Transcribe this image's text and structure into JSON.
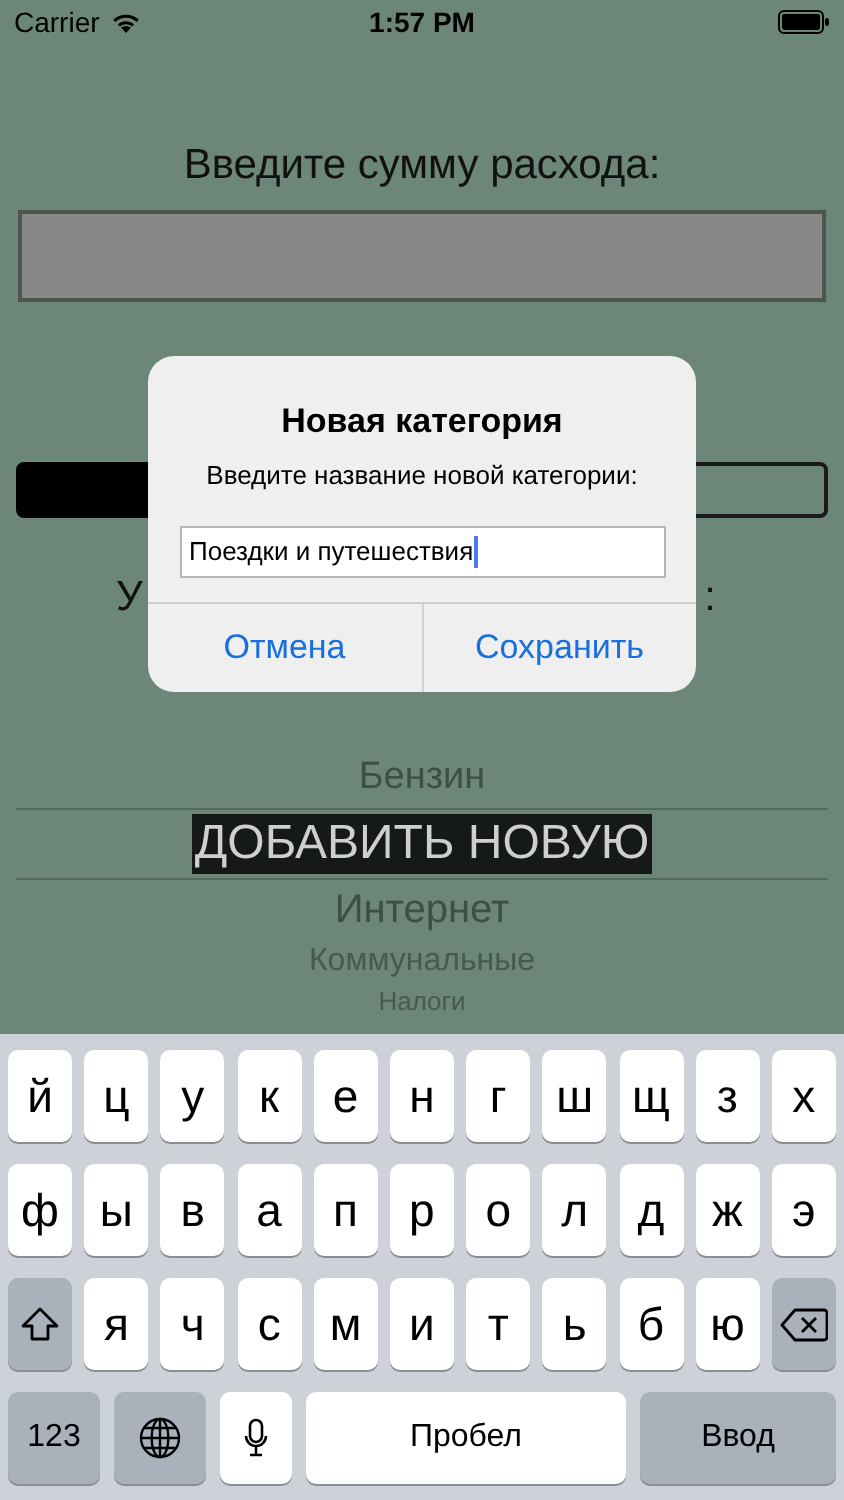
{
  "status_bar": {
    "carrier": "Carrier",
    "time": "1:57 PM"
  },
  "amount_label": "Введите сумму расхода:",
  "buttons_row": [
    {
      "kind": "filled"
    },
    {
      "kind": "outlined"
    }
  ],
  "covered_label": {
    "left": "У",
    "right": ":"
  },
  "picker": [
    {
      "label": "Бензин",
      "selected": false
    },
    {
      "label": "ДОБАВИТЬ НОВУЮ",
      "selected": true
    },
    {
      "label": "Интернет",
      "selected": false
    },
    {
      "label": "Коммунальные",
      "selected": false
    },
    {
      "label": "Налоги",
      "selected": false
    }
  ],
  "dialog": {
    "title": "Новая категория",
    "message": "Введите название новой категории:",
    "input": {
      "value": "Поездки и путешествия"
    },
    "buttons": [
      "Отмена",
      "Сохранить"
    ]
  },
  "keyboard": {
    "rows": [
      [
        {
          "kind": "letter",
          "label": "й"
        },
        {
          "kind": "letter",
          "label": "ц"
        },
        {
          "kind": "letter",
          "label": "у"
        },
        {
          "kind": "letter",
          "label": "к"
        },
        {
          "kind": "letter",
          "label": "е"
        },
        {
          "kind": "letter",
          "label": "н"
        },
        {
          "kind": "letter",
          "label": "г"
        },
        {
          "kind": "letter",
          "label": "ш"
        },
        {
          "kind": "letter",
          "label": "щ"
        },
        {
          "kind": "letter",
          "label": "з"
        },
        {
          "kind": "letter",
          "label": "х"
        }
      ],
      [
        {
          "kind": "letter",
          "label": "ф"
        },
        {
          "kind": "letter",
          "label": "ы"
        },
        {
          "kind": "letter",
          "label": "в"
        },
        {
          "kind": "letter",
          "label": "а"
        },
        {
          "kind": "letter",
          "label": "п"
        },
        {
          "kind": "letter",
          "label": "р"
        },
        {
          "kind": "letter",
          "label": "о"
        },
        {
          "kind": "letter",
          "label": "л"
        },
        {
          "kind": "letter",
          "label": "д"
        },
        {
          "kind": "letter",
          "label": "ж"
        },
        {
          "kind": "letter",
          "label": "э"
        }
      ],
      [
        {
          "kind": "shift"
        },
        {
          "kind": "letter",
          "label": "я"
        },
        {
          "kind": "letter",
          "label": "ч"
        },
        {
          "kind": "letter",
          "label": "с"
        },
        {
          "kind": "letter",
          "label": "м"
        },
        {
          "kind": "letter",
          "label": "и"
        },
        {
          "kind": "letter",
          "label": "т"
        },
        {
          "kind": "letter",
          "label": "ь"
        },
        {
          "kind": "letter",
          "label": "б"
        },
        {
          "kind": "letter",
          "label": "ю"
        },
        {
          "kind": "backspace"
        }
      ]
    ],
    "bottom_keys": [
      {
        "kind": "numbers",
        "label": "123"
      },
      {
        "kind": "globe"
      },
      {
        "kind": "mic"
      },
      {
        "kind": "space",
        "label": "Пробел"
      },
      {
        "kind": "return",
        "label": "Ввод"
      }
    ]
  }
}
